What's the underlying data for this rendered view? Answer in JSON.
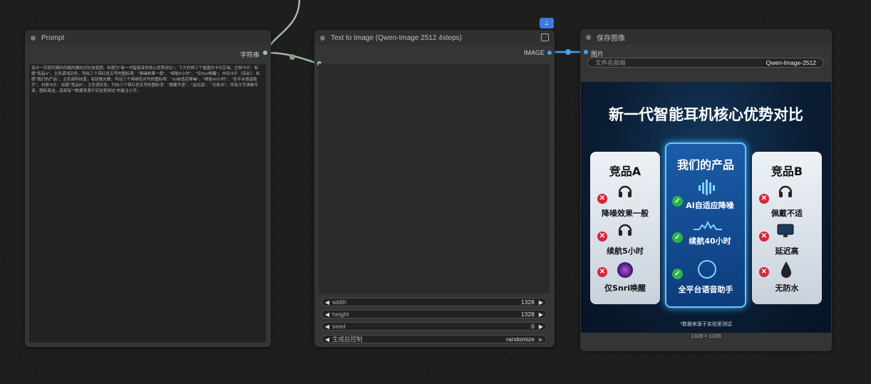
{
  "prompt_node": {
    "title": "Prompt",
    "output_label": "字符串",
    "text": "设计一页现代简约风格的横向对比信息图。标题为\"新一代智能耳机核心优势对比\"。下方并排三个垂直的卡片区域。左侧卡片：标题\"竞品A\"，主色调浅灰色，列出三个带红色叉号的图标项：\"降噪效果一般\"、\"续航5小时\"、\"仅Siri唤醒\"。中间卡片（突出）：标题\"我们的产品\"，主色调科技蓝，有轻微光晕，列出三个带绿色对号的图标项：\"AI自适应降噪\"、\"续航40小时\"、\"全平台语音助手\"。右侧卡片：标题\"竞品B\"，主色调灰色，列出三个带红色叉号的图标项：\"佩戴不适\"、\"延迟高\"、\"无防水\"。所有文字清晰可读，图标简洁。底部有\"*数据来源于实验室测试\"的备注小字。"
  },
  "t2i_node": {
    "title": "Text to Image (Qwen-Image 2512 4steps)",
    "output_label": "IMAGE",
    "widgets": [
      {
        "label": "width",
        "value": "1328"
      },
      {
        "label": "height",
        "value": "1328"
      },
      {
        "label": "seed",
        "value": "0"
      },
      {
        "label": "生成后控制",
        "value": "randomize"
      }
    ]
  },
  "save_node": {
    "title": "保存图像",
    "input_label": "图片",
    "prefix_label": "文件名前缀",
    "prefix_value": "Qwen-Image-2512",
    "dimensions": "1328 × 1328"
  },
  "poster": {
    "title": "新一代智能耳机核心优势对比",
    "footnote": "*数据来源于实验室测试",
    "left_card": {
      "title": "竞品A",
      "items": [
        "降噪效果一般",
        "续航5小时",
        "仅Snri唤醒"
      ]
    },
    "mid_card": {
      "title": "我们的产品",
      "items": [
        "AI自适应降噪",
        "续航40小时",
        "全平台语音助手"
      ]
    },
    "right_card": {
      "title": "竞品B",
      "items": [
        "佩戴不适",
        "延迟高",
        "无防水"
      ]
    }
  },
  "colors": {
    "accent_blue": "#4a9fe8",
    "link_green": "#8fd18f",
    "node_bg": "#353535"
  },
  "icons": [
    "subgraph-icon",
    "expand-icon",
    "headphone-icon",
    "waveform-icon",
    "monitor-icon",
    "water-drop-icon"
  ]
}
